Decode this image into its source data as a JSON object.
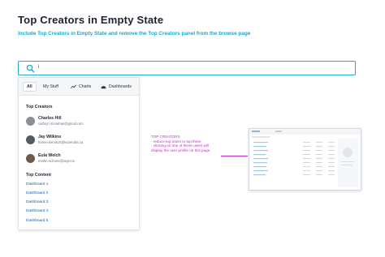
{
  "page": {
    "title": "Top Creators in Empty State",
    "subtitle": "Include Top Creators in Empty State and remove the Top Creators panel from the browse page"
  },
  "search": {
    "value": "i",
    "icon": "search-icon",
    "accent": "#1ea8c9"
  },
  "tabs": [
    {
      "label": "All",
      "active": true
    },
    {
      "label": "My Stuff"
    },
    {
      "label": "Charts",
      "icon": "chart-line-icon"
    },
    {
      "label": "Dashboards",
      "icon": "dashboard-icon"
    }
  ],
  "top_creators": {
    "heading": "Top Creators",
    "items": [
      {
        "name": "Charles Hill",
        "email": "cathryn.monahan@gmail.com"
      },
      {
        "name": "Jay Wilkins",
        "email": "homer.kirmisch@kozendra.ca"
      },
      {
        "name": "Eula Welch",
        "email": "martin.schoen@boyer.tv"
      }
    ]
  },
  "top_content": {
    "heading": "Top Content",
    "items": [
      "Dashboard 1",
      "Dashboard 2",
      "Dashboard 3",
      "Dashboard 4",
      "Dashboard 5"
    ],
    "link_color": "#1a5fa8"
  },
  "annotation": {
    "lines": [
      "TOP CREATORS",
      "- reduce top users to top three",
      "- clicking on one of these users will",
      "  display the user profile on this page"
    ],
    "color": "#c030c8"
  }
}
